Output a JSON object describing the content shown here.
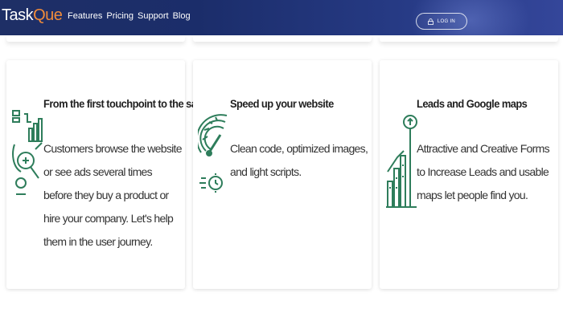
{
  "header": {
    "logo_part1": "Task",
    "logo_part2": "Que",
    "nav": [
      "Features",
      "Pricing",
      "Support",
      "Blog"
    ],
    "login_label": "LOG IN"
  },
  "colors": {
    "accent_green": "#2e7d5b",
    "header_blue": "#1e2f66",
    "logo_orange": "#f08b3a"
  },
  "cards": [
    {
      "title": "From the first touchpoint to the sale",
      "text": "Customers browse the website or see ads several times before they buy a product or hire your company. Let's help them in the user journey.",
      "icon": "customer-journey-icon"
    },
    {
      "title": "Speed up your website",
      "text": "Clean code, optimized images, and light scripts.",
      "icon": "speedometer-icon"
    },
    {
      "title": "Leads and Google maps",
      "text": "Attractive and Creative Forms to Increase Leads and usable maps let people find you.",
      "icon": "growth-chart-icon"
    }
  ]
}
